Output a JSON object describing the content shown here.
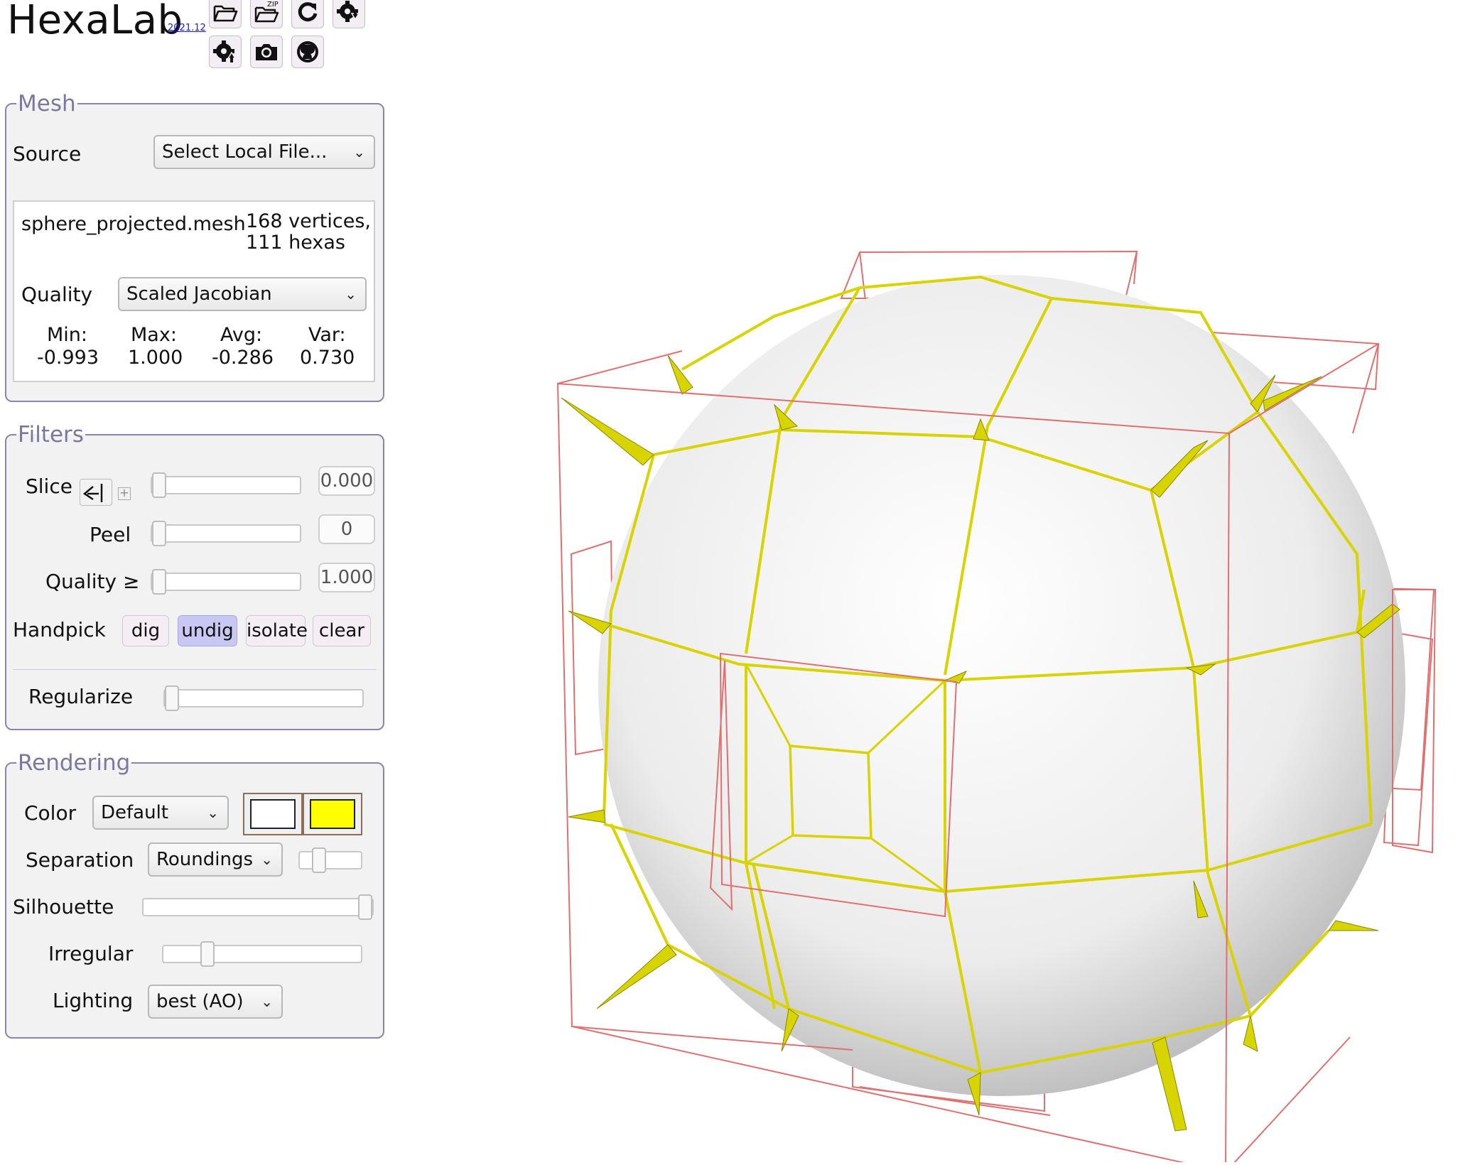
{
  "app": {
    "title": "HexaLab",
    "version": "2021.12"
  },
  "toolbar": {
    "buttons": [
      {
        "icon": "folder-open-icon"
      },
      {
        "icon": "folder-zip-icon",
        "badge": "ZIP"
      },
      {
        "icon": "reload-icon"
      },
      {
        "icon": "settings-download-icon"
      },
      {
        "icon": "settings-upload-icon"
      },
      {
        "icon": "camera-icon"
      },
      {
        "icon": "github-icon"
      }
    ]
  },
  "mesh": {
    "legend": "Mesh",
    "source_label": "Source",
    "source_value": "Select Local File...",
    "file_name": "sphere_projected.mesh",
    "stats_line1": "168 vertices,",
    "stats_line2": "111 hexas",
    "quality_label": "Quality",
    "quality_value": "Scaled Jacobian",
    "stats": [
      {
        "label": "Min:",
        "value": "-0.993"
      },
      {
        "label": "Max:",
        "value": "1.000"
      },
      {
        "label": "Avg:",
        "value": "-0.286"
      },
      {
        "label": "Var:",
        "value": "0.730"
      }
    ]
  },
  "filters": {
    "legend": "Filters",
    "slice_label": "Slice",
    "slice_value": "0.000",
    "slice_fraction": 0.0,
    "peel_label": "Peel",
    "peel_value": "0",
    "quality_label": "Quality ≥",
    "quality_value": "1.000",
    "handpick_label": "Handpick",
    "handpick_buttons": [
      "dig",
      "undig",
      "isolate",
      "clear"
    ],
    "handpick_active": "undig",
    "regularize_label": "Regularize",
    "regularize_fraction": 0.0
  },
  "rendering": {
    "legend": "Rendering",
    "color_label": "Color",
    "color_value": "Default",
    "color_swatch_1": "#ffffff",
    "color_swatch_2": "#ffff00",
    "separation_label": "Separation",
    "separation_value": "Roundings",
    "separation_fraction": 0.25,
    "silhouette_label": "Silhouette",
    "silhouette_fraction": 1.0,
    "irregular_label": "Irregular",
    "irregular_fraction": 0.2,
    "lighting_label": "Lighting",
    "lighting_value": "best (AO)"
  },
  "viewport": {
    "colors": {
      "surface": "#f2f2f2",
      "edge": "#e8e000",
      "wireframe": "#e05a5a",
      "spike": "#d8d400"
    }
  }
}
